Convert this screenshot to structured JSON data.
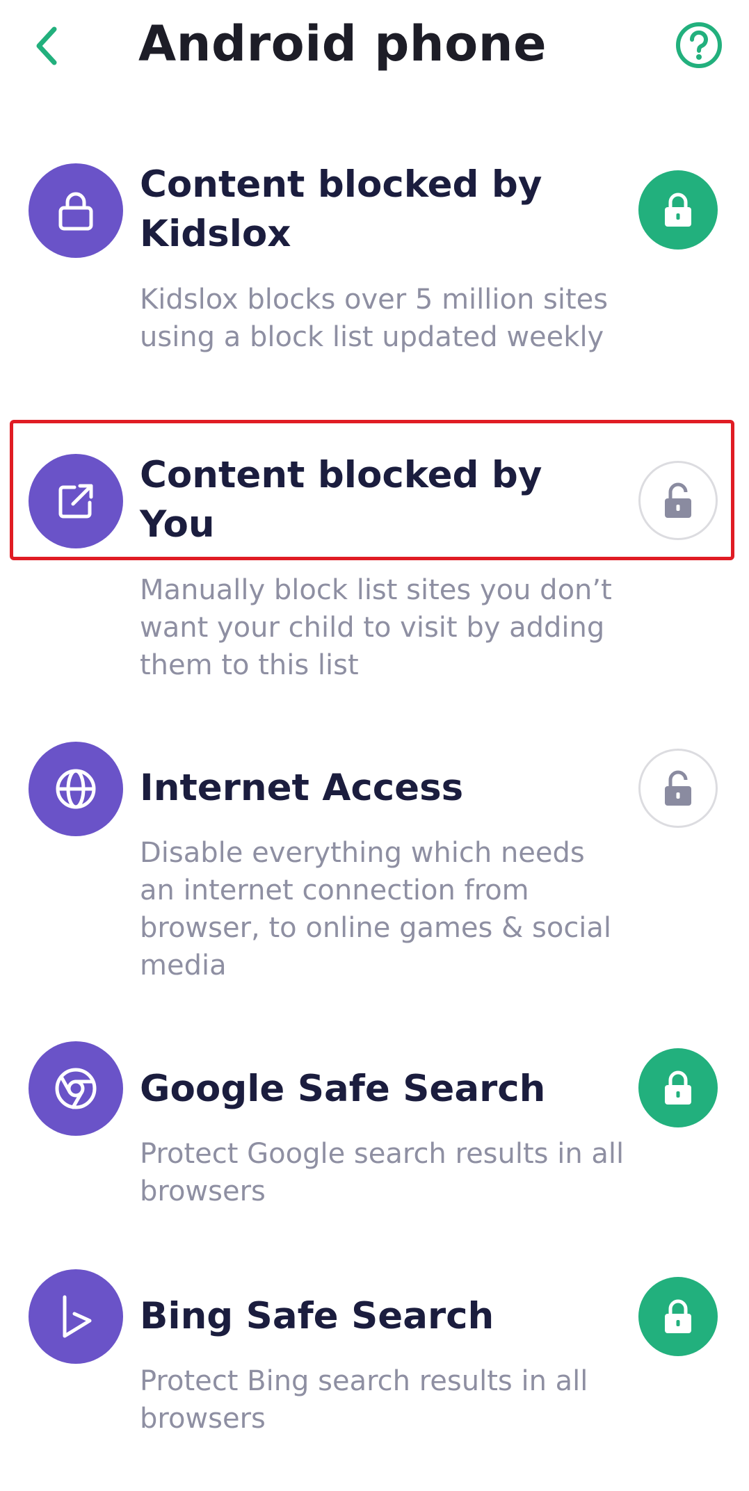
{
  "header": {
    "title": "Android phone",
    "back_icon": "chevron-left-icon",
    "help_icon": "question-circle-icon"
  },
  "colors": {
    "accent_green": "#22b07d",
    "icon_purple": "#6a53c8",
    "title_dark": "#1b1d3e",
    "desc_gray": "#8e8fa2",
    "highlight_red": "#e01c24"
  },
  "items": [
    {
      "title": "Content blocked by Kidslox",
      "description": "Kidslox blocks over 5 million sites using a block list updated weekly",
      "icon": "lock-icon",
      "toggle_state": "locked"
    },
    {
      "title": "Content blocked by You",
      "description": "Manually block list sites you don’t want your child to visit by adding them to this list",
      "icon": "external-link-icon",
      "toggle_state": "unlocked"
    },
    {
      "title": "Internet Access",
      "description": "Disable everything which needs an internet connection from browser, to online games & social media",
      "icon": "globe-icon",
      "toggle_state": "unlocked"
    },
    {
      "title": "Google Safe Search",
      "description": "Protect Google search results in all browsers",
      "icon": "chrome-icon",
      "toggle_state": "locked"
    },
    {
      "title": "Bing Safe Search",
      "description": "Protect Bing search results in all browsers",
      "icon": "bing-icon",
      "toggle_state": "locked"
    }
  ]
}
